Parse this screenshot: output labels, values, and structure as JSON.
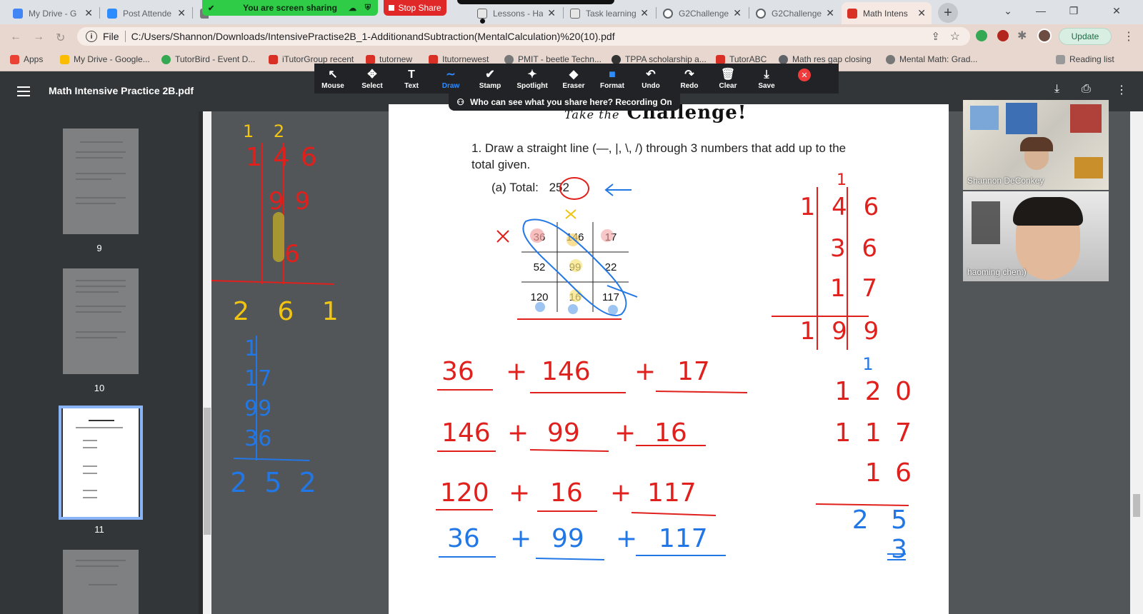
{
  "browser": {
    "tabs": [
      {
        "title": "My Drive - G",
        "color": "#4285f4"
      },
      {
        "title": "Post Attende",
        "color": "#2d8cff"
      },
      {
        "title": "",
        "color": "#777777"
      },
      {
        "title": "Lessons - Ha",
        "color": "#555555"
      },
      {
        "title": "Task learning",
        "color": "#555555"
      },
      {
        "title": "G2Challenge",
        "color": "#5f6368"
      },
      {
        "title": "G2Challenge",
        "color": "#5f6368"
      },
      {
        "title": "Math Intens",
        "color": "#d93025",
        "active": true
      }
    ],
    "new_tab": "+",
    "address": {
      "scheme_label": "File",
      "url": "C:/Users/Shannon/Downloads/IntensivePractise2B_1-AdditionandSubtraction(MentalCalculation)%20(10).pdf"
    },
    "update_label": "Update",
    "bookmarks": [
      {
        "label": "Apps",
        "color": "#ea4335"
      },
      {
        "label": "My Drive - Google...",
        "color": "#fbbc04"
      },
      {
        "label": "TutorBird - Event D...",
        "color": "#34a853"
      },
      {
        "label": "iTutorGroup recent",
        "color": "#d93025"
      },
      {
        "label": "tutornew",
        "color": "#d93025"
      },
      {
        "label": "Itutornewest",
        "color": "#d93025"
      },
      {
        "label": "PMIT - beetle Techn...",
        "color": "#777777"
      },
      {
        "label": "TPPA scholarship a...",
        "color": "#333333"
      },
      {
        "label": "TutorABC",
        "color": "#d93025"
      },
      {
        "label": "Math res gap closing",
        "color": "#5f6368"
      },
      {
        "label": "Mental Math: Grad...",
        "color": "#777777"
      },
      {
        "label": "Reading list",
        "color": "#999999"
      }
    ]
  },
  "zoom": {
    "sharing_banner": "You are screen sharing",
    "stop_share": "Stop Share",
    "tools": [
      {
        "label": "Mouse",
        "icon": "↖"
      },
      {
        "label": "Select",
        "icon": "✥"
      },
      {
        "label": "Text",
        "icon": "T"
      },
      {
        "label": "Draw",
        "icon": "∼",
        "selected": true
      },
      {
        "label": "Stamp",
        "icon": "✔"
      },
      {
        "label": "Spotlight",
        "icon": "✦"
      },
      {
        "label": "Eraser",
        "icon": "◆"
      },
      {
        "label": "Format",
        "icon": "■"
      },
      {
        "label": "Undo",
        "icon": "↶"
      },
      {
        "label": "Redo",
        "icon": "↷"
      },
      {
        "label": "Clear",
        "icon": "🗑"
      },
      {
        "label": "Save",
        "icon": "⤓"
      }
    ],
    "recording_notice": "Who can see what you share here? Recording On",
    "participants": [
      {
        "name": "Shannon DeConkey"
      },
      {
        "name": "haoming chen:)"
      }
    ]
  },
  "pdf": {
    "title": "Math Intensive Practice 2B.pdf",
    "thumb_pages": [
      "9",
      "10",
      "11"
    ],
    "page": {
      "header_small": "Take the",
      "header_big": "Challenge!",
      "question": "1.  Draw a straight line (—, |, \\, /) through 3 numbers that add up to the total given.",
      "part_a_label": "(a)  Total:",
      "total": "252",
      "grid": [
        [
          "36",
          "146",
          "17"
        ],
        [
          "52",
          "99",
          "22"
        ],
        [
          "120",
          "16",
          "117"
        ]
      ]
    }
  },
  "handwriting": {
    "left_red_top": "1 2",
    "left_red_col1": "1 4 6",
    "left_red_col2": "9 9",
    "left_red_col3": "6",
    "left_yellow_sum": "2 6 1",
    "left_blue_col": "1 17 99 36",
    "left_blue_sum": "2 5 2",
    "mid_rows": [
      {
        "a": "36",
        "b": "146",
        "c": "17",
        "color": "#e0201c"
      },
      {
        "a": "146",
        "b": "99",
        "c": "16",
        "color": "#e0201c"
      },
      {
        "a": "120",
        "b": "16",
        "c": "117",
        "color": "#e0201c"
      },
      {
        "a": "36",
        "b": "99",
        "c": "117",
        "color": "#2277e6"
      }
    ],
    "right_red_col": [
      "1",
      "1 4 6",
      "3 6",
      "1 7",
      "1 9 9"
    ],
    "right_blue_col": [
      "1",
      "1 2 0",
      "1 1 7",
      "1 6",
      "2 5 3"
    ]
  }
}
